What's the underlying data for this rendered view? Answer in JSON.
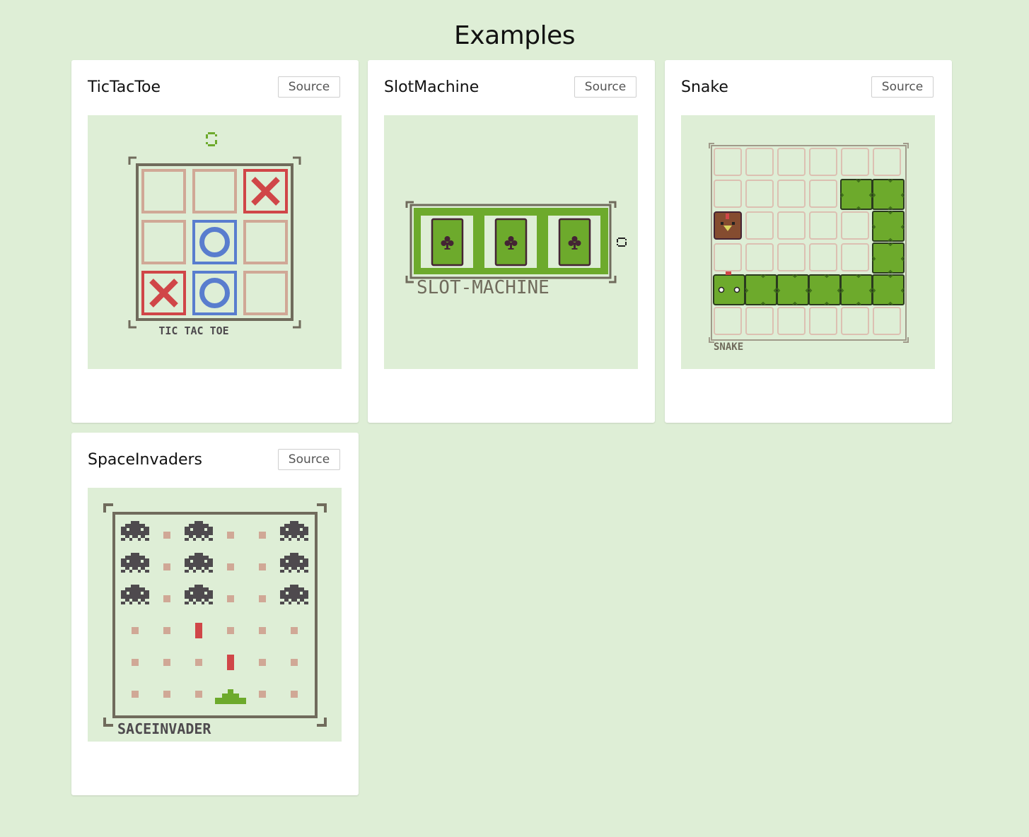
{
  "page": {
    "title": "Examples"
  },
  "colors": {
    "background": "#deeed6",
    "frame": "#706b5c",
    "empty_cell": "#d0a896",
    "x_red": "#d04648",
    "o_blue": "#597dce",
    "green": "#6daa2c",
    "dark": "#442434",
    "invader": "#4e4a4e"
  },
  "examples": [
    {
      "title": "TicTacToe",
      "source_label": "Source",
      "game_label": "TIC TAC TOE",
      "board": [
        "",
        "",
        "X",
        "",
        "O",
        "",
        "X",
        "O",
        ""
      ]
    },
    {
      "title": "SlotMachine",
      "source_label": "Source",
      "game_label": "SLOT-MACHINE",
      "reels": [
        "club",
        "club",
        "club"
      ]
    },
    {
      "title": "Snake",
      "source_label": "Source",
      "game_label": "SNAKE"
    },
    {
      "title": "SpaceInvaders",
      "source_label": "Source",
      "game_label": "SACEINVADER"
    }
  ],
  "icons": [
    "refresh-icon",
    "club-icon",
    "chicken-icon",
    "snake-head-icon",
    "invader-icon",
    "cannon-icon"
  ]
}
